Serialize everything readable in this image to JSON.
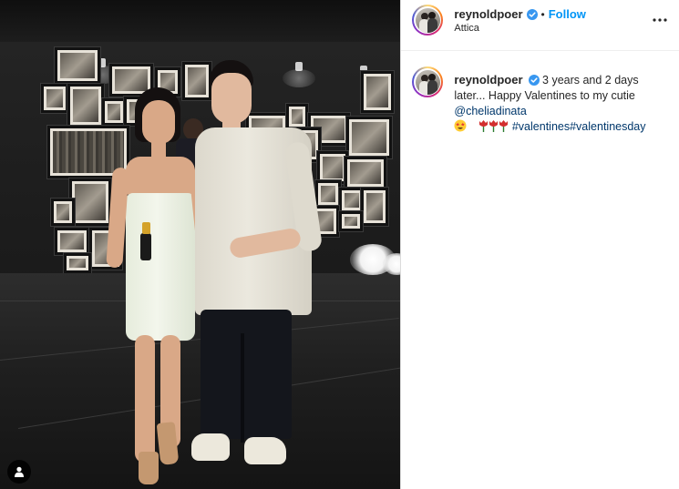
{
  "post": {
    "username": "reynoldpoer",
    "follow_label": "Follow",
    "separator": "•",
    "location": "Attica",
    "caption": {
      "username": "reynoldpoer",
      "text": "3 years and 2 days later... Happy Valentines to my cutie",
      "mention": "@cheliadinata",
      "hashtags": [
        "#valentines",
        "#valentinesday"
      ]
    }
  },
  "icons": {
    "verified": "verified-badge-icon",
    "more": "more-options-icon",
    "user_tag": "user-tag-icon"
  },
  "colors": {
    "accent": "#0095f6",
    "link": "#00376b",
    "text": "#262626",
    "border": "#dbdbdb"
  }
}
